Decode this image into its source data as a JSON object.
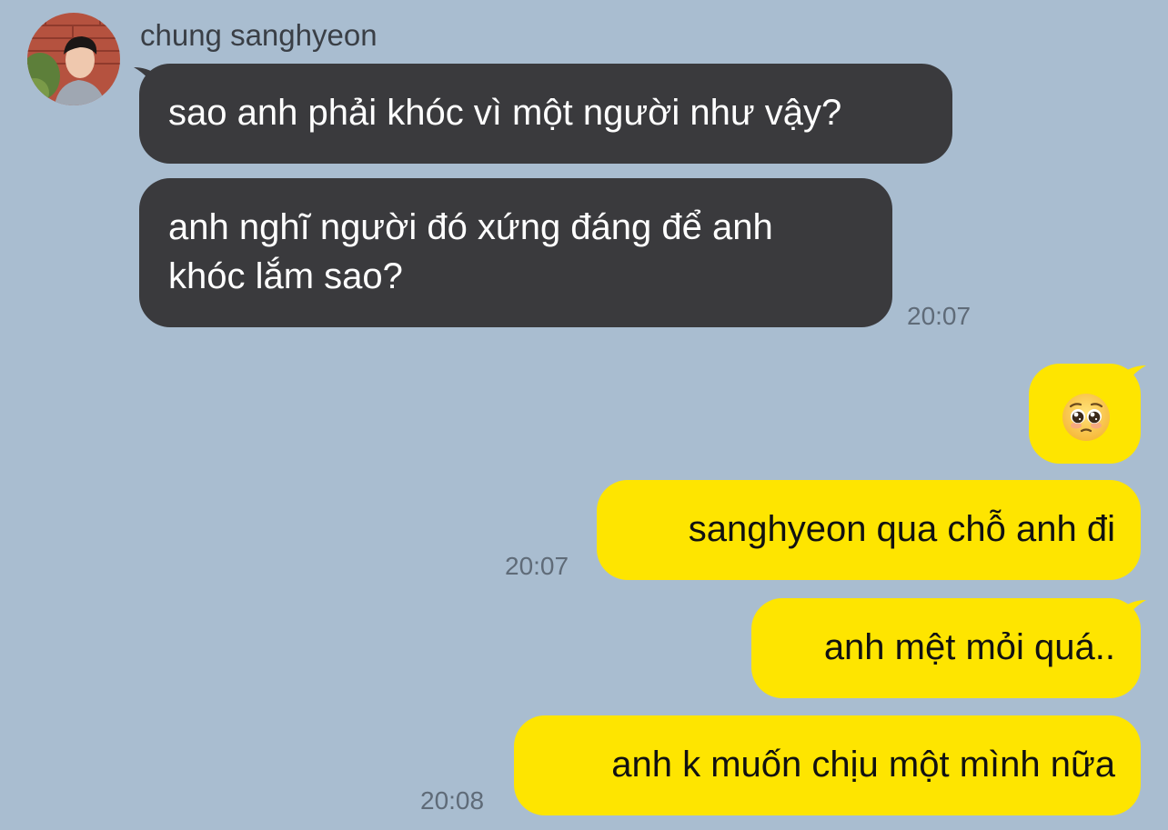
{
  "chat": {
    "sender_name": "chung sanghyeon",
    "colors": {
      "background": "#a9bdd0",
      "incoming_bubble": "#3a3a3d",
      "outgoing_bubble": "#fee500",
      "timestamp_text": "#5f6b78"
    },
    "messages": [
      {
        "direction": "incoming",
        "text": "sao anh phải khóc vì một người như vậy?"
      },
      {
        "direction": "incoming",
        "text_lines": [
          "anh nghĩ người đó xứng đáng để anh",
          "khóc lắm sao?"
        ],
        "time": "20:07"
      },
      {
        "direction": "outgoing",
        "emoji": "pleading-face-emoji"
      },
      {
        "direction": "outgoing",
        "text": "sanghyeon qua chỗ anh đi",
        "time": "20:07"
      },
      {
        "direction": "outgoing",
        "text": "anh mệt mỏi quá.."
      },
      {
        "direction": "outgoing",
        "text": "anh k muốn chịu một mình nữa",
        "time": "20:08"
      }
    ]
  }
}
